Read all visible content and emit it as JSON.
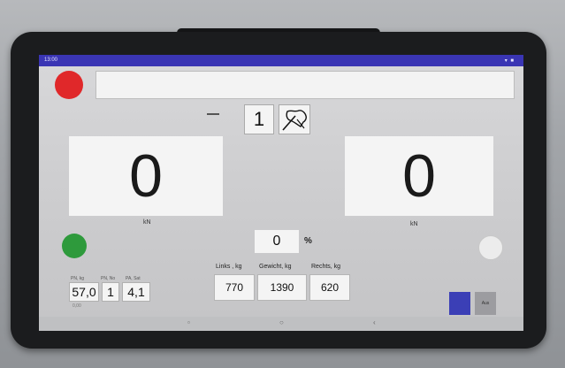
{
  "status_bar": {
    "time": "13:00",
    "icons": "▾ ■"
  },
  "header": {
    "input_value": ""
  },
  "selector": {
    "count": "1"
  },
  "readings": {
    "left_value": "0",
    "right_value": "0",
    "left_unit": "kN",
    "right_unit": "kN"
  },
  "percent": {
    "value": "0",
    "sign": "%"
  },
  "weights": {
    "links_label": "Links , kg",
    "gewicht_label": "Gewicht, kg",
    "rechts_label": "Rechts, kg",
    "links_value": "770",
    "gewicht_value": "1390",
    "rechts_value": "620"
  },
  "small_fields": {
    "label_1": "PN, kg",
    "label_2": "PN, No",
    "label_3": "PA, Sat",
    "value_1": "57,0",
    "value_2": "1",
    "value_3": "4,1",
    "sub_text": "0,00"
  },
  "buttons": {
    "aux_label": "Aus"
  },
  "nav": {
    "home": "▫",
    "circle": "○",
    "back": "‹"
  },
  "colors": {
    "status_bar": "#3a35b4",
    "record_dot": "#e0282a",
    "green_dot": "#2e9a3c",
    "blue_button": "#3b3fb6"
  }
}
